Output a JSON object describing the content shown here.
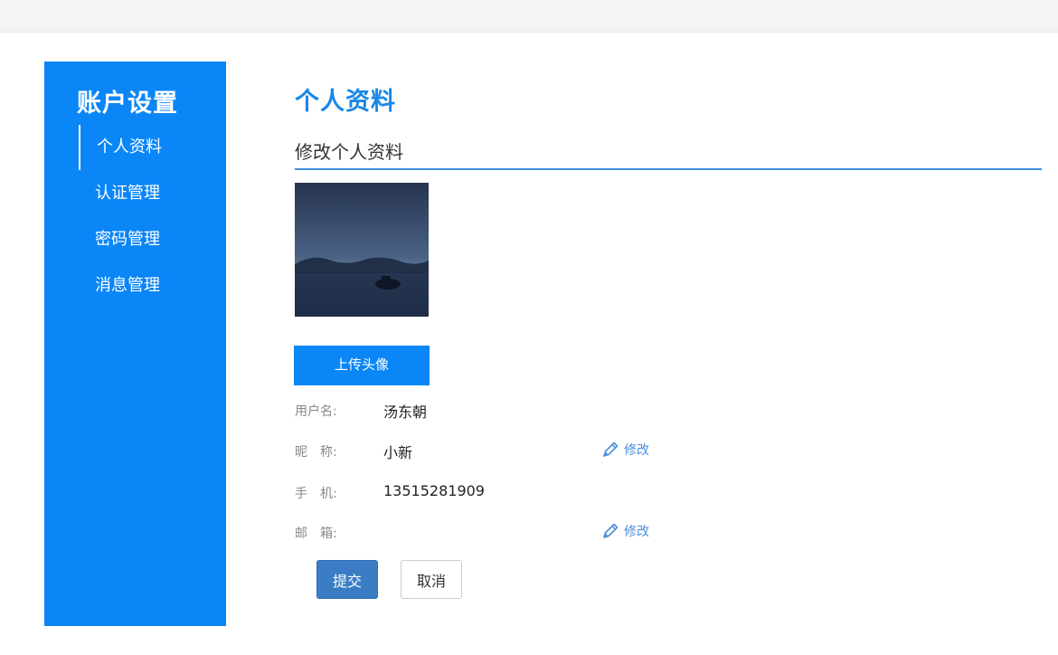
{
  "sidebar": {
    "title": "账户设置",
    "items": [
      {
        "label": "个人资料",
        "active": true
      },
      {
        "label": "认证管理",
        "active": false
      },
      {
        "label": "密码管理",
        "active": false
      },
      {
        "label": "消息管理",
        "active": false
      }
    ]
  },
  "main": {
    "page_title": "个人资料",
    "section_title": "修改个人资料",
    "upload_label": "上传头像",
    "fields": [
      {
        "label": "用户名:",
        "value": "汤东朝"
      },
      {
        "label": "昵　称:",
        "value": "小新",
        "edit_label": "修改"
      },
      {
        "label": "手　机:",
        "value": "13515281909"
      },
      {
        "label": "邮　箱:",
        "value": "",
        "edit_label": "修改"
      }
    ],
    "submit_label": "提交",
    "cancel_label": "取消"
  },
  "colors": {
    "sidebar_bg": "#0a86f7",
    "accent": "#1a86e8",
    "submit_bg": "#3a7dc4",
    "edit_link": "#4a8fd9"
  },
  "icons": {
    "edit": "pencil-icon"
  }
}
